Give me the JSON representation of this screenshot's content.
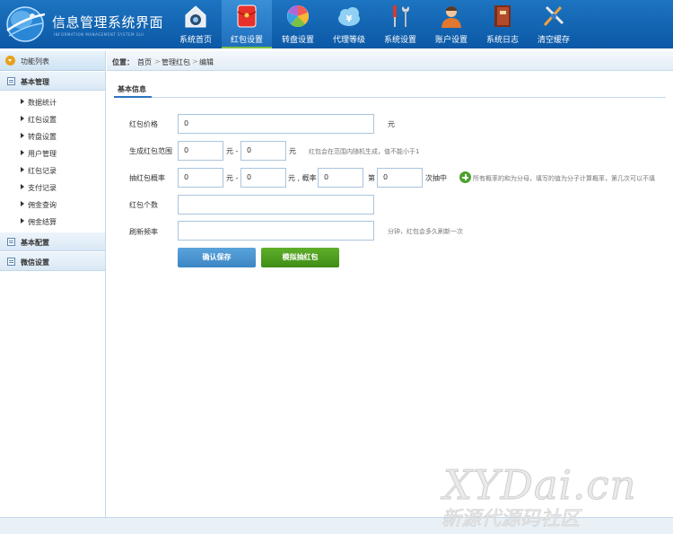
{
  "app": {
    "title": "信息管理系统界面",
    "subtitle": "INFORMATION MANAGEMENT SYSTEM GUI"
  },
  "nav": [
    {
      "label": "系统首页",
      "icon": "home-camera-icon"
    },
    {
      "label": "红包设置",
      "icon": "red-envelope-icon",
      "active": true
    },
    {
      "label": "转盘设置",
      "icon": "color-wheel-icon"
    },
    {
      "label": "代理等级",
      "icon": "yen-cloud-icon"
    },
    {
      "label": "系统设置",
      "icon": "tools-icon"
    },
    {
      "label": "账户设置",
      "icon": "user-icon"
    },
    {
      "label": "系统日志",
      "icon": "book-icon"
    },
    {
      "label": "清空缓存",
      "icon": "cleanup-tools-icon"
    }
  ],
  "sidebar": {
    "header": "功能列表",
    "sections": [
      {
        "label": "基本管理",
        "items": [
          "数据统计",
          "红包设置",
          "转盘设置",
          "用户管理",
          "红包记录",
          "支付记录",
          "佣金查询",
          "佣金结算"
        ]
      },
      {
        "label": "基本配置"
      },
      {
        "label": "微信设置"
      }
    ]
  },
  "breadcrumb": {
    "prefix": "位置：",
    "items": [
      "首页",
      "管理红包",
      "编辑"
    ],
    "separator": ">"
  },
  "panel": {
    "title": "基本信息"
  },
  "form": {
    "price": {
      "label": "红包价格",
      "value": "0",
      "unit": "元"
    },
    "range": {
      "label": "生成红包范围",
      "min": "0",
      "max": "0",
      "sep": "元 -",
      "unit": "元",
      "hint": "红包会在范围内随机生成，值不能小于1"
    },
    "prob": {
      "label": "抽红包概率",
      "min": "0",
      "max": "0",
      "sep": "元 -",
      "unit_prob": "元 , 概率",
      "n": "0",
      "word_di": "第",
      "m": "0",
      "word_hit": "次抽中",
      "hint": "所有概率的和为分母，填写的值为分子计算概率，第几次可以不填"
    },
    "count": {
      "label": "红包个数",
      "value": ""
    },
    "refresh": {
      "label": "刷新频率",
      "value": "",
      "hint": "分钟，红包会多久刷新一次"
    }
  },
  "buttons": {
    "save": "确认保存",
    "simulate": "模拟抽红包"
  },
  "watermark": {
    "line1": "XYDai.cn",
    "line2": "新源代源码社区"
  },
  "colors": {
    "header": "#0b58a6",
    "active_tab": "#7bc143",
    "save_button": "#3c86c4",
    "simulate_button": "#3f8d16",
    "plus_icon": "#4aa12b"
  }
}
